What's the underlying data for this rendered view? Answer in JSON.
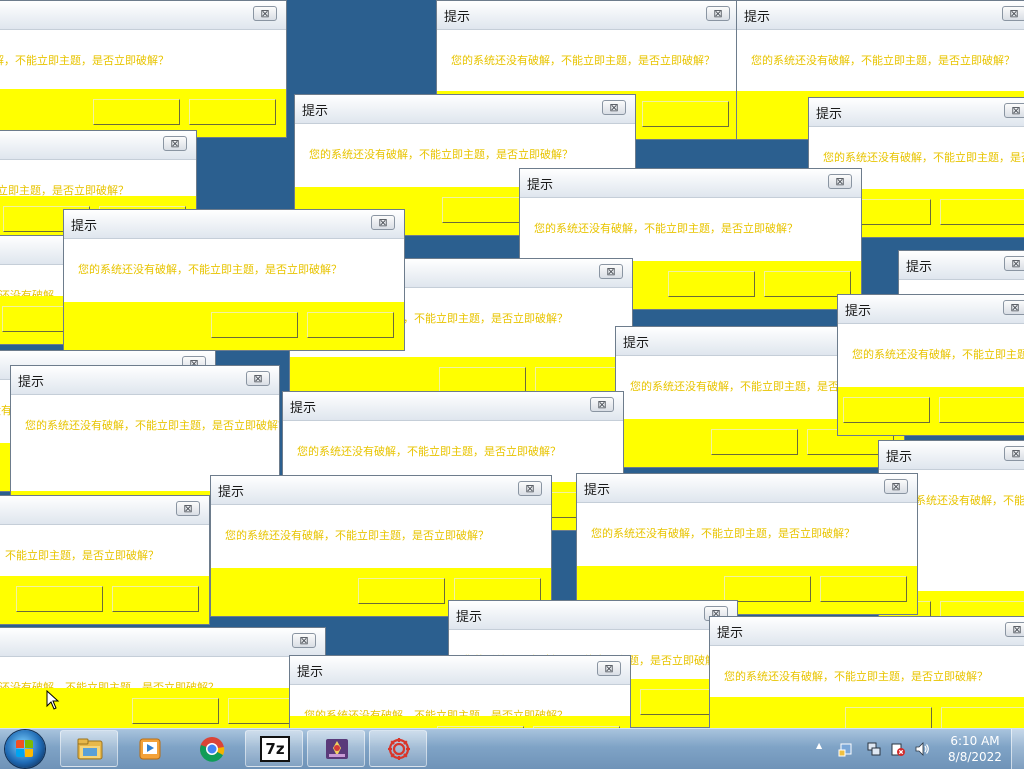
{
  "dialog": {
    "title": "提示",
    "close_glyph": "⊠",
    "message": "您的系统还没有破解，不能立即主题，是否立即破解？",
    "button_color": "#ffff00",
    "message_color": "#e8c400"
  },
  "taskbar": {
    "start_icon": "windows-start-orb",
    "pinned": [
      {
        "name": "explorer",
        "icon": "folder-icon"
      },
      {
        "name": "media-player",
        "icon": "media-player-icon"
      },
      {
        "name": "chrome",
        "icon": "chrome-icon"
      },
      {
        "name": "7zip",
        "icon": "7zip-icon"
      },
      {
        "name": "app",
        "icon": "app-icon"
      },
      {
        "name": "settings",
        "icon": "gear-icon"
      }
    ],
    "sevenzip_label": "7z",
    "tray_expand": "▲",
    "clock_time": "6:10 AM",
    "clock_date": "8/8/2022"
  }
}
